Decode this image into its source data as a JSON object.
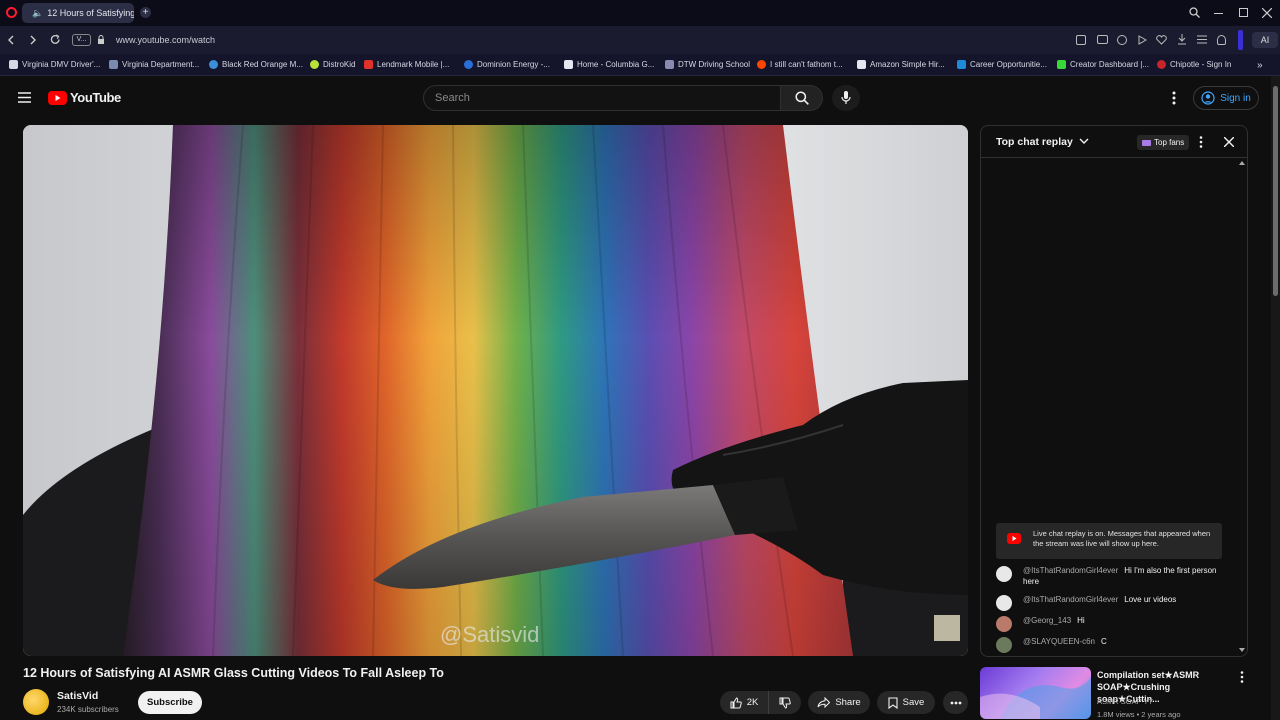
{
  "browser": {
    "tab_title": "12 Hours of Satisfying",
    "url": "www.youtube.com/watch",
    "site_badge": "V...",
    "ai_label": "AI",
    "bookmarks": [
      "Virginia DMV Driver'...",
      "Virginia Department...",
      "Black Red Orange M...",
      "DistroKid",
      "Lendmark Mobile |...",
      "Dominion Energy -...",
      "Home - Columbia G...",
      "DTW Driving School",
      "I still can't fathom t...",
      "Amazon Simple Hir...",
      "Career Opportunitie...",
      "Creator Dashboard |...",
      "Chipotle - Sign In"
    ]
  },
  "youtube": {
    "logo_text": "YouTube",
    "search_placeholder": "Search",
    "sign_in": "Sign in"
  },
  "video": {
    "watermark": "@Satisvid",
    "title": "12 Hours of Satisfying AI ASMR Glass Cutting Videos To Fall Asleep To",
    "channel": "SatisVid",
    "subscribers": "234K subscribers",
    "subscribe": "Subscribe",
    "likes": "2K",
    "share": "Share",
    "save": "Save"
  },
  "chat": {
    "title": "Top chat replay",
    "top_fans": "Top fans",
    "notice": "Live chat replay is on. Messages that appeared when the stream was live will show up here.",
    "messages": [
      {
        "author": "@ItsThatRandomGirl4ever",
        "text": "Hi I'm also the first person here"
      },
      {
        "author": "@ItsThatRandomGirl4ever",
        "text": "Love ur videos"
      },
      {
        "author": "@Georg_143",
        "text": "Hi"
      },
      {
        "author": "@SLAYQUEEN-c6n",
        "text": "C"
      }
    ]
  },
  "recommendation": {
    "title": "Compilation set★ASMR SOAP★Crushing soap★Cuttin...",
    "channel": "ASMR SOAP YT",
    "meta": "1.8M views • 2 years ago"
  },
  "colors": {
    "youtube_red": "#ff0000",
    "link_blue": "#3ea6ff",
    "background": "#0f0f0f"
  }
}
